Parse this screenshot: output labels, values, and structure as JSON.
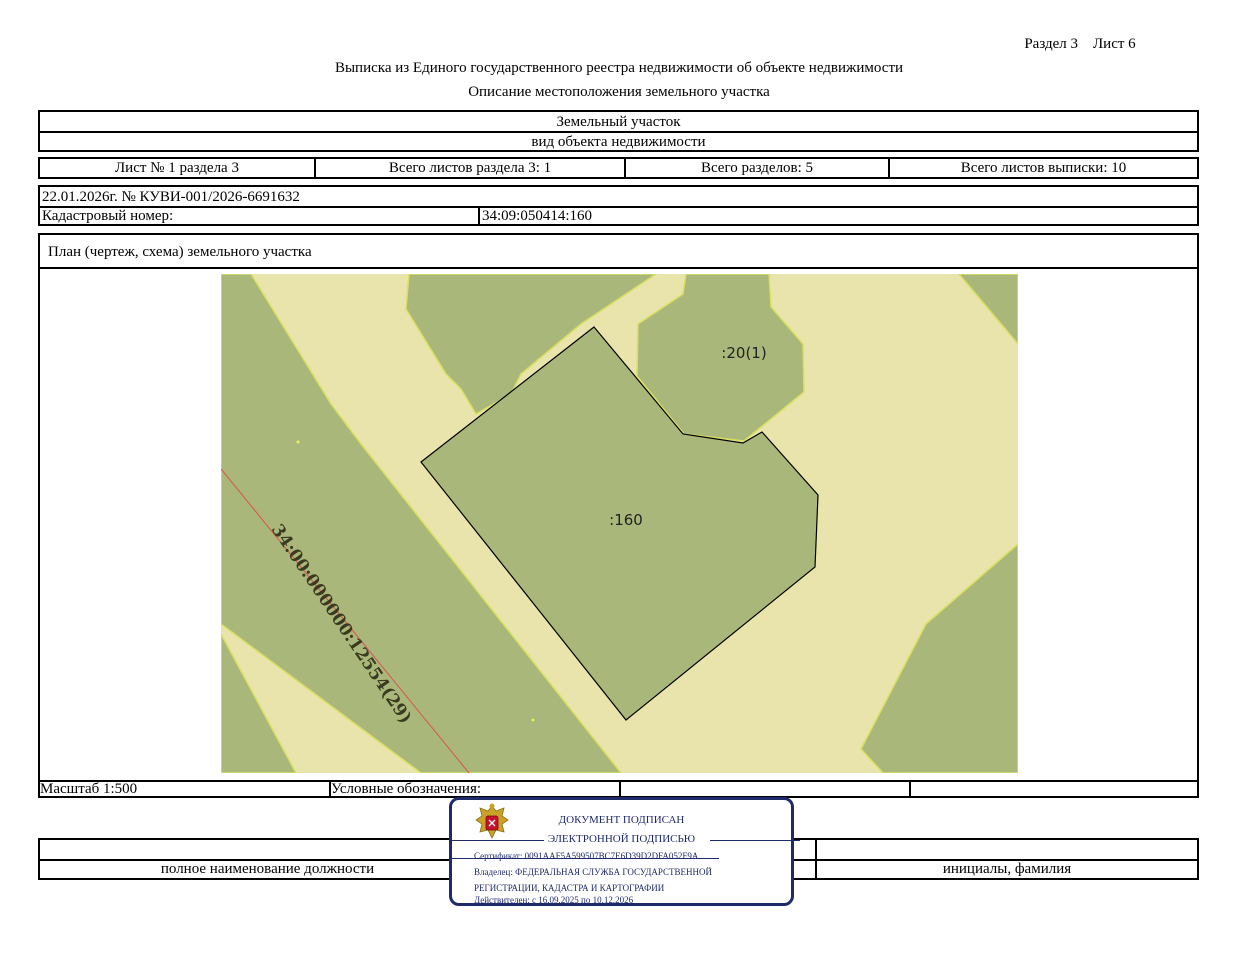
{
  "header": {
    "section_sheet": "Раздел 3    Лист 6"
  },
  "titles": {
    "main": "Выписка из Единого государственного реестра недвижимости об объекте недвижимости",
    "sub": "Описание местоположения земельного участка"
  },
  "object": {
    "type": "Земельный участок",
    "type_caption": "вид объекта недвижимости"
  },
  "sheet_info": {
    "sheet_no": "Лист № 1 раздела 3",
    "total_sheets_section": "Всего листов раздела 3: 1",
    "total_sections": "Всего разделов: 5",
    "total_sheets_extract": "Всего листов выписки: 10"
  },
  "record": {
    "date_number": "22.01.2026г. № КУВИ-001/2026-6691632",
    "cadastral_label": "Кадастровый номер:",
    "cadastral_value": "34:09:050414:160"
  },
  "plan": {
    "caption": "План (чертеж, схема) земельного участка",
    "labels": {
      "parcel_main": ":160",
      "parcel_neighbor": ":20(1)",
      "road_parcel": "34:00:000000:12554(29)"
    }
  },
  "footer": {
    "scale": "Масштаб 1:500",
    "legend_label": "Условные обозначения:",
    "position_caption": "полное наименование должности",
    "name_caption": "инициалы, фамилия"
  },
  "stamp": {
    "line1": "ДОКУМЕНТ ПОДПИСАН",
    "line2": "ЭЛЕКТРОННОЙ ПОДПИСЬЮ",
    "certificate": "Сертификат: 0091AAF5A599507BC7E6D39D2DFA052F9A",
    "owner1": "Владелец: ФЕДЕРАЛЬНАЯ СЛУЖБА ГОСУДАРСТВЕННОЙ",
    "owner2": "РЕГИСТРАЦИИ, КАДАСТРА И КАРТОГРАФИИ",
    "valid": "Действителен: с 16.09.2025 по 10.12.2026"
  },
  "colors": {
    "map_light": "#e8e4ac",
    "map_dark": "#aab77a",
    "stamp_blue": "#1f2a6b",
    "road_line": "#d9534f"
  }
}
